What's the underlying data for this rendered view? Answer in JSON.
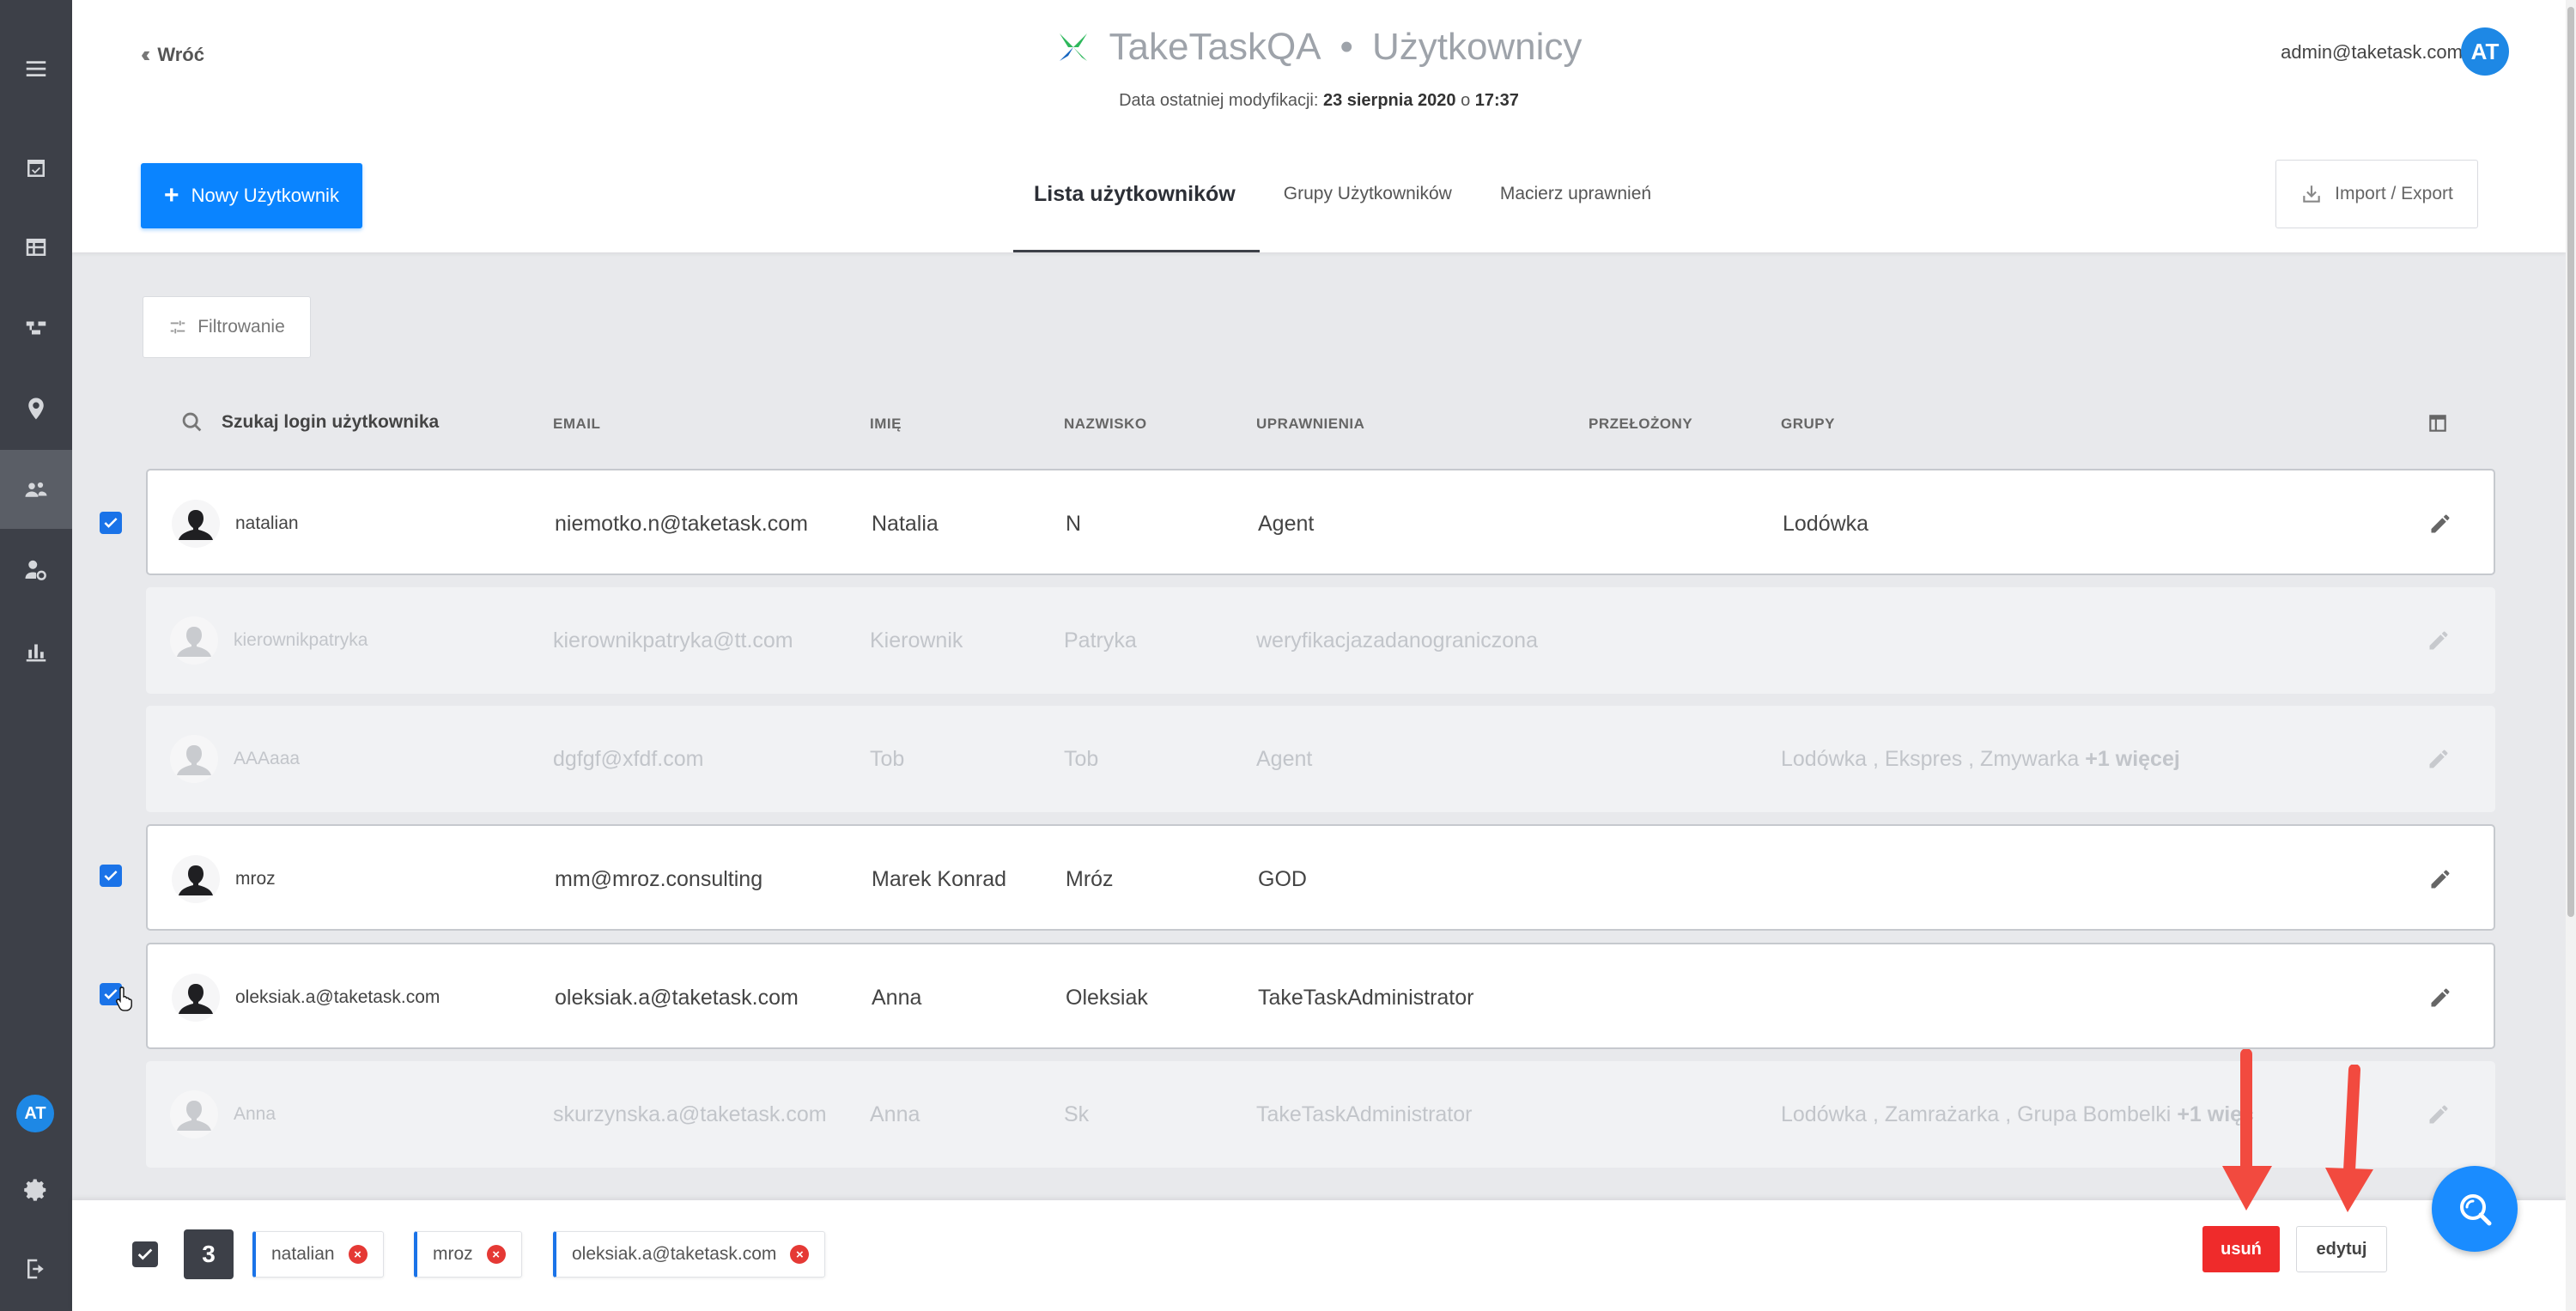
{
  "sidebar": {
    "items": [
      {
        "icon": "menu-icon"
      },
      {
        "icon": "tasks-icon"
      },
      {
        "icon": "table-icon"
      },
      {
        "icon": "workflow-icon"
      },
      {
        "icon": "location-icon"
      },
      {
        "icon": "users-icon"
      },
      {
        "icon": "user-settings-icon"
      },
      {
        "icon": "reports-icon"
      }
    ],
    "avatar_initials": "AT",
    "bottom_icons": [
      "gear-icon",
      "logout-icon"
    ]
  },
  "header": {
    "back_label": "Wróć",
    "app_name": "TakeTaskQA",
    "separator": "•",
    "section": "Użytkownicy",
    "modified_prefix": "Data ostatniej modyfikacji:",
    "modified_date": "23 sierpnia 2020",
    "modified_mid": "o",
    "modified_time": "17:37",
    "user_email": "admin@taketask.com",
    "user_initials": "AT",
    "logo_colors": {
      "green": "#2eb85c",
      "blue": "#1565c0"
    }
  },
  "toolbar": {
    "new_user_label": "Nowy Użytkownik",
    "import_export_label": "Import / Export",
    "filter_label": "Filtrowanie"
  },
  "tabs": [
    {
      "label": "Lista użytkowników",
      "active": true
    },
    {
      "label": "Grupy Użytkowników",
      "active": false
    },
    {
      "label": "Macierz uprawnień",
      "active": false
    }
  ],
  "table": {
    "search_placeholder": "Szukaj login użytkownika",
    "columns": {
      "email": "EMAIL",
      "first_name": "IMIĘ",
      "last_name": "NAZWISKO",
      "permissions": "UPRAWNIENIA",
      "supervisor": "PRZEŁOŻONY",
      "groups": "GRUPY"
    },
    "rows": [
      {
        "login": "natalian",
        "email": "niemotko.n@taketask.com",
        "first_name": "Natalia",
        "last_name": "N",
        "permissions": "Agent",
        "supervisor": "",
        "groups": "Lodówka",
        "groups_more": "",
        "selected": true
      },
      {
        "login": "kierownikpatryka",
        "email": "kierownikpatryka@tt.com",
        "first_name": "Kierownik",
        "last_name": "Patryka",
        "permissions": "weryfikacjazadanograniczona",
        "supervisor": "",
        "groups": "",
        "groups_more": "",
        "selected": false
      },
      {
        "login": "AAAaaa",
        "email": "dgfgf@xfdf.com",
        "first_name": "Tob",
        "last_name": "Tob",
        "permissions": "Agent",
        "supervisor": "",
        "groups": "Lodówka , Ekspres , Zmywarka",
        "groups_more": "+1 więcej",
        "selected": false
      },
      {
        "login": "mroz",
        "email": "mm@mroz.consulting",
        "first_name": "Marek Konrad",
        "last_name": "Mróz",
        "permissions": "GOD",
        "supervisor": "",
        "groups": "",
        "groups_more": "",
        "selected": true
      },
      {
        "login": "oleksiak.a@taketask.com",
        "email": "oleksiak.a@taketask.com",
        "first_name": "Anna",
        "last_name": "Oleksiak",
        "permissions": "TakeTaskAdministrator",
        "supervisor": "",
        "groups": "",
        "groups_more": "",
        "selected": true
      },
      {
        "login": "Anna",
        "email": "skurzynska.a@taketask.com",
        "first_name": "Anna",
        "last_name": "Sk",
        "permissions": "TakeTaskAdministrator",
        "supervisor": "",
        "groups": "Lodówka , Zamrażarka , Grupa Bombelki",
        "groups_more": "+1 więc",
        "selected": false
      }
    ]
  },
  "bottom_bar": {
    "selected_count": "3",
    "chips": [
      "natalian",
      "mroz",
      "oleksiak.a@taketask.com"
    ],
    "chip_remove_glyph": "×",
    "delete_label": "usuń",
    "edit_label": "edytuj"
  },
  "colors": {
    "primary": "#0a84ff",
    "danger": "#ef2b2b",
    "sidebar": "#3d4048",
    "annotation_arrow": "#f24a3f"
  }
}
